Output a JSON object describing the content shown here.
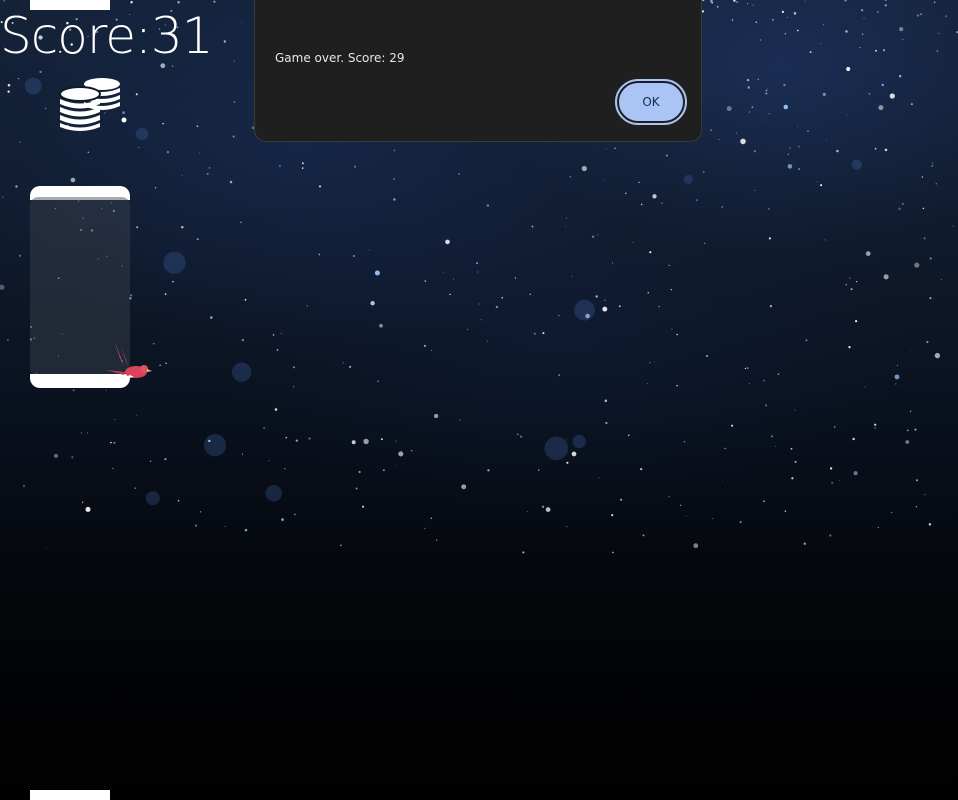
{
  "game": {
    "score_text": "Score:31",
    "coins_icon": "coins-icon",
    "bird_icon": "bird-icon"
  },
  "dialog": {
    "message": "Game over. Score: 29",
    "ok_label": "OK"
  },
  "colors": {
    "dialog_bg": "#1f1f1f",
    "ok_button": "#a9c4f5",
    "text": "#ffffff"
  }
}
